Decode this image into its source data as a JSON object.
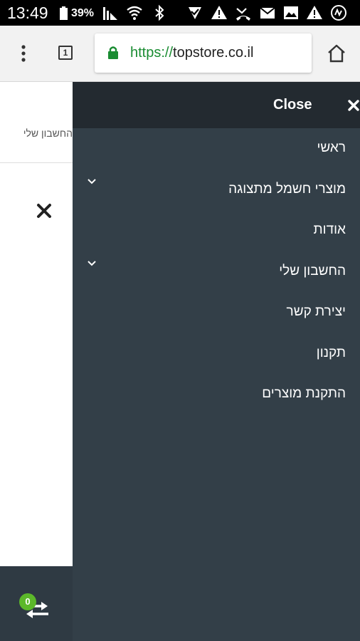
{
  "status_bar": {
    "time": "13:49",
    "battery": "39%",
    "icons": [
      "battery-icon",
      "signal-icon",
      "wifi-icon",
      "bluetooth-icon",
      "check-icon",
      "warning-icon",
      "missed-call-icon",
      "mail-icon",
      "image-icon",
      "warning-icon",
      "app-icon"
    ]
  },
  "browser": {
    "tab_count": "1",
    "url_scheme": "https://",
    "url_host": "topstore.co.il"
  },
  "background_page": {
    "account_text": "החשבון שלי",
    "compare_count": "0"
  },
  "menu": {
    "close_label": "Close",
    "items": [
      {
        "label": "ראשי",
        "has_submenu": false
      },
      {
        "label": "מוצרי חשמל מתצוגה",
        "has_submenu": true
      },
      {
        "label": "אודות",
        "has_submenu": false
      },
      {
        "label": "החשבון שלי",
        "has_submenu": true
      },
      {
        "label": "יצירת קשר",
        "has_submenu": false
      },
      {
        "label": "תקנון",
        "has_submenu": false
      },
      {
        "label": "התקנת מוצרים",
        "has_submenu": false
      }
    ]
  },
  "colors": {
    "menu_bg": "#333f48",
    "menu_header_bg": "#232a30",
    "secure_green": "#1a8c32",
    "badge_green": "#5cb82a"
  }
}
